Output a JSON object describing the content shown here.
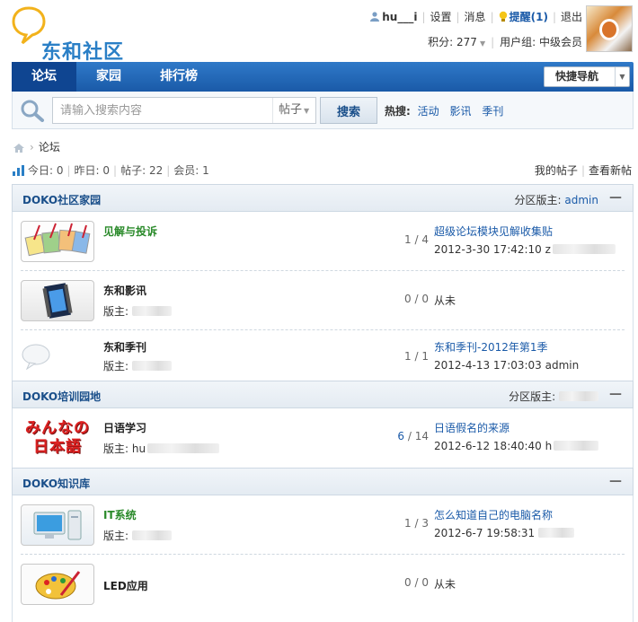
{
  "header": {
    "logo_text": "东和社区",
    "username": "hu___i",
    "settings": "设置",
    "messages": "消息",
    "reminder": "提醒(1)",
    "logout": "退出",
    "points_label": "积分: 277",
    "usergroup_label": "用户组: 中级会员"
  },
  "nav": {
    "items": [
      {
        "label": "论坛",
        "active": true
      },
      {
        "label": "家园",
        "active": false
      },
      {
        "label": "排行榜",
        "active": false
      }
    ],
    "quick_nav": "快捷导航"
  },
  "search": {
    "placeholder": "请输入搜索内容",
    "type": "帖子",
    "button": "搜索",
    "hot_label": "热搜:",
    "hot_terms": [
      "活动",
      "影讯",
      "季刊"
    ]
  },
  "breadcrumb": {
    "current": "论坛"
  },
  "stats": {
    "today": "今日: 0",
    "yesterday": "昨日: 0",
    "posts": "帖子: 22",
    "members": "会员: 1",
    "my_posts": "我的帖子",
    "new_posts": "查看新帖"
  },
  "categories": [
    {
      "title": "DOKO社区家园",
      "mod_label": "分区版主:",
      "mod_name": "admin",
      "collapse": "—",
      "forums": [
        {
          "name": "见解与投诉",
          "mod": "",
          "count_topics": "1",
          "count_posts": "4",
          "last_title": "超级论坛模块见解收集贴",
          "last_time": "2012-3-30 17:42:10 z"
        },
        {
          "name": "东和影讯",
          "mod": "版主:",
          "count_topics": "0",
          "count_posts": "0",
          "last_title": "",
          "last_time": "从未"
        },
        {
          "name": "东和季刊",
          "mod": "版主:",
          "count_topics": "1",
          "count_posts": "1",
          "last_title": "东和季刊-2012年第1季",
          "last_time": "2012-4-13 17:03:03 admin"
        }
      ]
    },
    {
      "title": "DOKO培训园地",
      "mod_label": "分区版主:",
      "mod_name": "",
      "collapse": "—",
      "forums": [
        {
          "name": "日语学习",
          "mod": "版主: hu",
          "count_topics": "6",
          "count_posts": "14",
          "last_title": "日语假名的来源",
          "last_time": "2012-6-12 18:40:40 h",
          "icon_text": "みんなの日本語"
        }
      ]
    },
    {
      "title": "DOKO知识库",
      "mod_label": "",
      "mod_name": "",
      "collapse": "—",
      "forums": [
        {
          "name": "IT系统",
          "mod": "版主:",
          "count_topics": "1",
          "count_posts": "3",
          "last_title": "怎么知道自己的电脑名称",
          "last_time": "2012-6-7 19:58:31"
        },
        {
          "name": "LED应用",
          "mod": "",
          "count_topics": "0",
          "count_posts": "0",
          "last_title": "",
          "last_time": "从未"
        }
      ]
    }
  ],
  "colors": {
    "nav_blue": "#1a5aa8",
    "link_blue": "#1a5aa8",
    "forum_green": "#2a8a2a"
  }
}
